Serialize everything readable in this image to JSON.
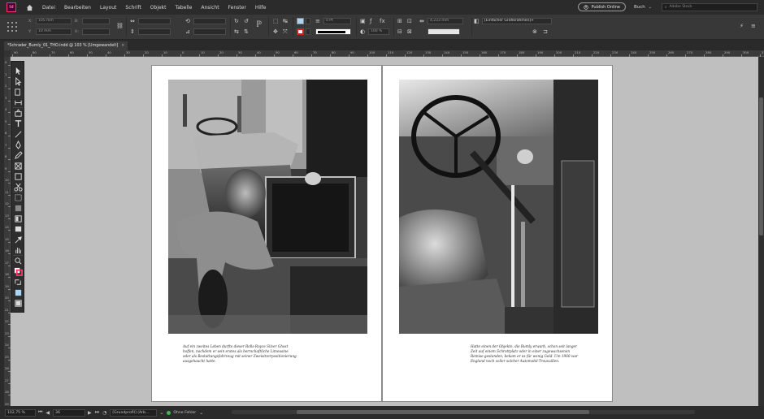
{
  "window": {
    "app_icon": "Id",
    "menu": [
      "Datei",
      "Bearbeiten",
      "Layout",
      "Schrift",
      "Objekt",
      "Tabelle",
      "Ansicht",
      "Fenster",
      "Hilfe"
    ],
    "publish_label": "Publish Online",
    "workspace_label": "Buch",
    "search_placeholder": "Adobe Stock"
  },
  "control_panel": {
    "x_label": "X:",
    "y_label": "Y:",
    "w_label": "B:",
    "h_label": "H:",
    "x_value": "105 mm",
    "y_value": "10 mm",
    "stroke_weight": "0 Pt",
    "opacity": "100 %",
    "spacing": "4,233 mm",
    "object_style": "[Einfacher Grafikrahmen]+"
  },
  "document": {
    "tab_title": "*Schrader_Bumly_01_THO.indd @ 103 % [Umgewandelt]",
    "close": "×"
  },
  "ruler": {
    "h_ticks": [
      "90",
      "80",
      "70",
      "60",
      "50",
      "40",
      "30",
      "20",
      "10",
      "0",
      "10",
      "20",
      "30",
      "40",
      "50",
      "60",
      "70",
      "80",
      "90",
      "100",
      "110",
      "120",
      "130",
      "140",
      "150",
      "160",
      "170",
      "180",
      "190",
      "200",
      "210",
      "220",
      "230",
      "240",
      "250",
      "260",
      "270",
      "280",
      "290",
      "300",
      "310"
    ],
    "v_ticks": [
      "0",
      "1",
      "2",
      "3",
      "4",
      "5",
      "6",
      "7",
      "8",
      "9",
      "10",
      "11",
      "12",
      "13",
      "14",
      "15",
      "16",
      "17",
      "18",
      "19",
      "20",
      "21",
      "22",
      "23",
      "24",
      "25",
      "26",
      "27",
      "28",
      "29"
    ]
  },
  "pages": {
    "left_caption": [
      "Auf ein zweites Leben durfte dieser Rolls-Royce Silver Ghost",
      "hoffen, nachdem er sein erstes als herrschaftliche Limousine",
      "oder als Bestattungsfahrzeug mit seiner Zweisitzerpositionierung",
      "ausgehaucht hatte."
    ],
    "right_caption": [
      "Hatte einen der Objekte, die Bumly erwarb, schon seit langer",
      "Zeit auf einem Schrottplatz oder in einer zugewachsenen",
      "Remise gestanden, bekam er es für wenig Geld. Um 1960 war",
      "England noch voller solcher Automobil-Trouvaillen."
    ]
  },
  "status": {
    "zoom": "102,75 %",
    "page_number": "36",
    "profile": "[Grundprofil] (Arb...",
    "preflight": "Ohne Fehler"
  },
  "colors": {
    "accent_pink": "#ff3366",
    "preflight_ok": "#3fb950"
  }
}
